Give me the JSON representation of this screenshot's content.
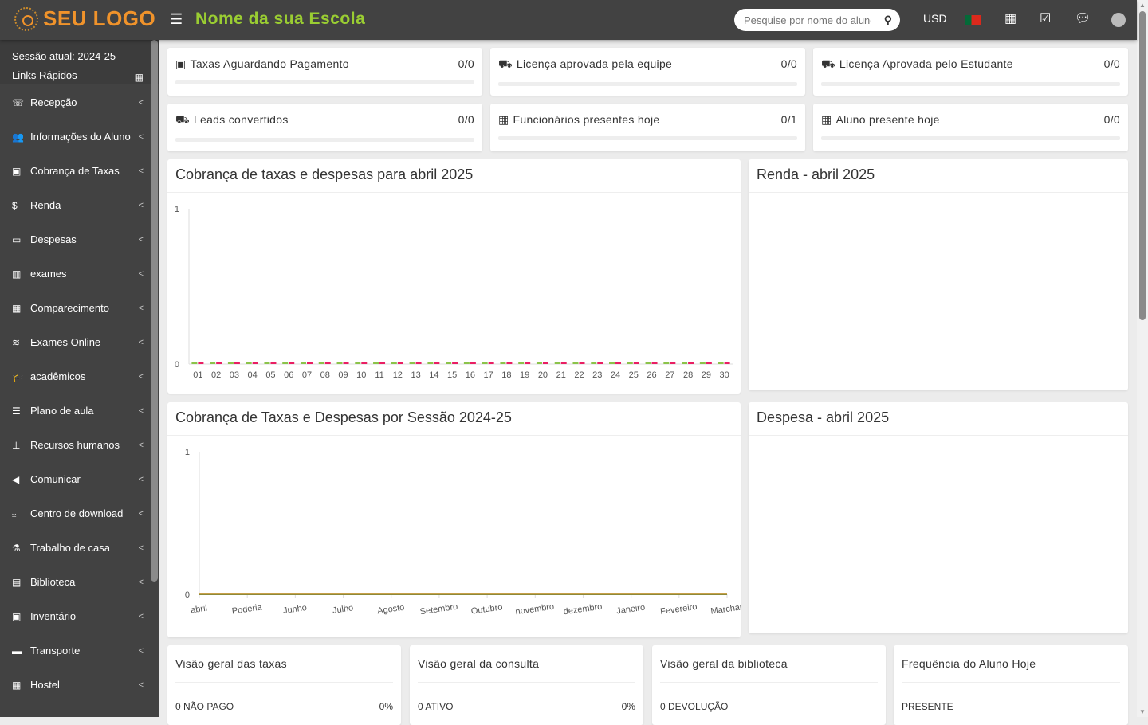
{
  "header": {
    "logo": "SEU LOGO",
    "school_name": "Nome da sua Escola",
    "search_placeholder": "Pesquise por nome do aluno",
    "currency": "USD",
    "language_flag": "Portugal",
    "icons": [
      "menu-icon",
      "search-icon",
      "calendar-icon",
      "check-square-icon",
      "chat-icon",
      "user-avatar"
    ]
  },
  "sidebar": {
    "session": "Sessão atual: 2024-25",
    "quick_links": "Links Rápidos",
    "items": [
      {
        "label": "Recepção",
        "icon": "recepcao-icon",
        "glyph": "☏"
      },
      {
        "label": "Informações do Aluno",
        "icon": "user-plus-icon",
        "glyph": "👥"
      },
      {
        "label": "Cobrança de Taxas",
        "icon": "money-icon",
        "glyph": "▣"
      },
      {
        "label": "Renda",
        "icon": "dollar-icon",
        "glyph": "$"
      },
      {
        "label": "Despesas",
        "icon": "credit-card-icon",
        "glyph": "▭"
      },
      {
        "label": "exames",
        "icon": "map-icon",
        "glyph": "▥"
      },
      {
        "label": "Comparecimento",
        "icon": "calendar-check-icon",
        "glyph": "▦"
      },
      {
        "label": "Exames Online",
        "icon": "rss-icon",
        "glyph": "≋"
      },
      {
        "label": "acadêmicos",
        "icon": "graduation-cap-icon",
        "glyph": "🎓"
      },
      {
        "label": "Plano de aula",
        "icon": "list-icon",
        "glyph": "☰"
      },
      {
        "label": "Recursos humanos",
        "icon": "sitemap-icon",
        "glyph": "⊥"
      },
      {
        "label": "Comunicar",
        "icon": "bullhorn-icon",
        "glyph": "◀"
      },
      {
        "label": "Centro de download",
        "icon": "download-icon",
        "glyph": "⤓"
      },
      {
        "label": "Trabalho de casa",
        "icon": "flask-icon",
        "glyph": "⚗"
      },
      {
        "label": "Biblioteca",
        "icon": "book-icon",
        "glyph": "▤"
      },
      {
        "label": "Inventário",
        "icon": "inventory-icon",
        "glyph": "▣"
      },
      {
        "label": "Transporte",
        "icon": "bus-icon",
        "glyph": "▬"
      },
      {
        "label": "Hostel",
        "icon": "building-icon",
        "glyph": "▦"
      }
    ]
  },
  "stats": [
    {
      "label": "Taxas Aguardando Pagamento",
      "value": "0/0",
      "icon": "money-icon",
      "progress": 0
    },
    {
      "label": "Licença aprovada pela equipe",
      "value": "0/0",
      "icon": "ambulance-icon",
      "progress": 0
    },
    {
      "label": "Licença Aprovada pelo Estudante",
      "value": "0/0",
      "icon": "ambulance-icon",
      "progress": 0
    },
    {
      "label": "Leads convertidos",
      "value": "0/0",
      "icon": "ambulance-icon",
      "progress": 0
    },
    {
      "label": "Funcionários presentes hoje",
      "value": "0/1",
      "icon": "calendar-check-icon",
      "progress": 0
    },
    {
      "label": "Aluno presente hoje",
      "value": "0/0",
      "icon": "calendar-check-icon",
      "progress": 0
    }
  ],
  "panels": {
    "renda": "Renda - abril 2025",
    "despesa": "Despesa - abril 2025"
  },
  "chart_data": [
    {
      "type": "bar",
      "title": "Cobrança de taxas e despesas para abril 2025",
      "categories": [
        "01",
        "02",
        "03",
        "04",
        "05",
        "06",
        "07",
        "08",
        "09",
        "10",
        "11",
        "12",
        "13",
        "14",
        "15",
        "16",
        "17",
        "18",
        "19",
        "20",
        "21",
        "22",
        "23",
        "24",
        "25",
        "26",
        "27",
        "28",
        "29",
        "30"
      ],
      "series": [
        {
          "color": "#8bc34a",
          "values": [
            0,
            0,
            0,
            0,
            0,
            0,
            0,
            0,
            0,
            0,
            0,
            0,
            0,
            0,
            0,
            0,
            0,
            0,
            0,
            0,
            0,
            0,
            0,
            0,
            0,
            0,
            0,
            0,
            0,
            0
          ]
        },
        {
          "color": "#e91e63",
          "values": [
            0,
            0,
            0,
            0,
            0,
            0,
            0,
            0,
            0,
            0,
            0,
            0,
            0,
            0,
            0,
            0,
            0,
            0,
            0,
            0,
            0,
            0,
            0,
            0,
            0,
            0,
            0,
            0,
            0,
            0
          ]
        }
      ],
      "yticks": [
        "0",
        "1"
      ],
      "ylim": [
        0,
        1
      ]
    },
    {
      "type": "line",
      "title": "Cobrança de Taxas e Despesas por Sessão 2024-25",
      "categories": [
        "abril",
        "Poderia",
        "Junho",
        "Julho",
        "Agosto",
        "Setembro",
        "Outubro",
        "novembro",
        "dezembro",
        "Janeiro",
        "Fevereiro",
        "Marchar"
      ],
      "series": [
        {
          "color": "#8d8a3a",
          "values": [
            0,
            0,
            0,
            0,
            0,
            0,
            0,
            0,
            0,
            0,
            0,
            0
          ]
        },
        {
          "color": "#c8a04a",
          "values": [
            0,
            0,
            0,
            0,
            0,
            0,
            0,
            0,
            0,
            0,
            0,
            0
          ]
        }
      ],
      "yticks": [
        "0",
        "1"
      ],
      "ylim": [
        0,
        1
      ]
    }
  ],
  "overview": [
    {
      "title": "Visão geral das taxas",
      "row": "0 NÃO PAGO",
      "pct": "0%"
    },
    {
      "title": "Visão geral da consulta",
      "row": "0 ATIVO",
      "pct": "0%"
    },
    {
      "title": "Visão geral da biblioteca",
      "row": "0 DEVOLUÇÃO",
      "pct": ""
    },
    {
      "title": "Frequência do Aluno Hoje",
      "row": "PRESENTE",
      "pct": ""
    }
  ]
}
